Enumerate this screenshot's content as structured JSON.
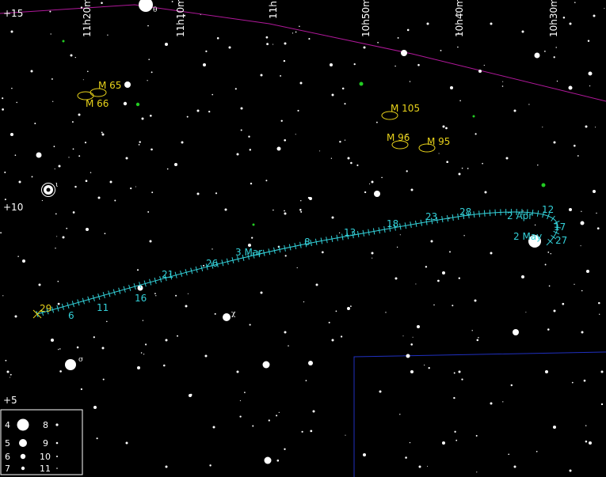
{
  "ra_labels": [
    "11h20m",
    "11h10m",
    "11h",
    "10h50m",
    "10h40m",
    "10h30m"
  ],
  "dec_labels": [
    "+15",
    "+10",
    "+5"
  ],
  "dso": [
    {
      "name": "M 65",
      "label": "M 65"
    },
    {
      "name": "M 66",
      "label": "M 66"
    },
    {
      "name": "M 105",
      "label": "M 105"
    },
    {
      "name": "M 96",
      "label": "M 96"
    },
    {
      "name": "M 95",
      "label": "M 95"
    }
  ],
  "track_dates": [
    "29",
    "6",
    "11",
    "16",
    "21",
    "26",
    "3 Mar",
    "8",
    "13",
    "18",
    "23",
    "28",
    "2 Apr",
    "12",
    "17",
    "2 May",
    "27"
  ],
  "greek_labels": [
    "θ",
    "ι",
    "χ",
    "σ"
  ],
  "legend": {
    "left": [
      "4",
      "5",
      "6",
      "7"
    ],
    "right": [
      "8",
      "9",
      "10",
      "11"
    ]
  },
  "colors": {
    "background": "#000000",
    "stars": "#ffffff",
    "dso": "#e8d21a",
    "track": "#33d0d8",
    "ecliptic": "#b0189a",
    "boundary": "#2030c0",
    "galaxy_dot": "#22cc22"
  }
}
